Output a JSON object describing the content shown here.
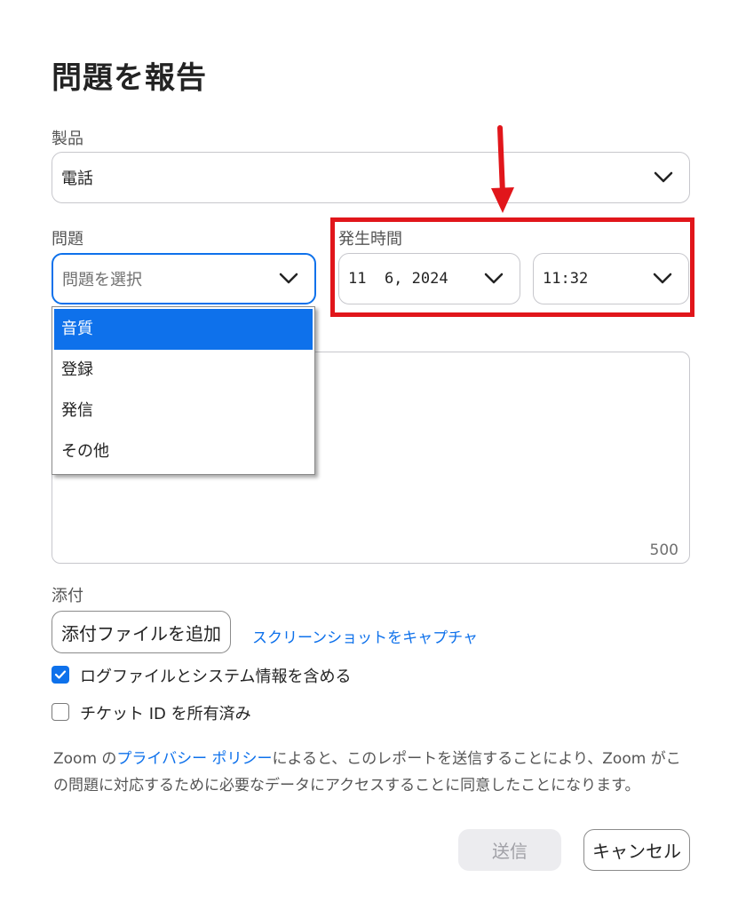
{
  "dialog": {
    "title": "問題を報告"
  },
  "product": {
    "label": "製品",
    "value": "電話"
  },
  "issue": {
    "label": "問題",
    "placeholder": "問題を選択",
    "options": [
      "音質",
      "登録",
      "発信",
      "その他"
    ],
    "highlighted_option": "音質"
  },
  "occurrence": {
    "label": "発生時間",
    "date_value": "11  6, 2024",
    "time_value": "11:32"
  },
  "description": {
    "char_counter": "500"
  },
  "attachments": {
    "label": "添付",
    "add_button": "添付ファイルを追加",
    "capture_link": "スクリーンショットをキャプチャ"
  },
  "checkboxes": [
    {
      "label": "ログファイルとシステム情報を含める",
      "checked": true
    },
    {
      "label": "チケット ID を所有済み",
      "checked": false
    }
  ],
  "privacy_note": {
    "before": "Zoom の",
    "link": "プライバシー ポリシー",
    "after": "によると、このレポートを送信することにより、Zoom がこの問題に対応するために必要なデータにアクセスすることに同意したことになります。"
  },
  "footer": {
    "submit_label": "送信",
    "cancel_label": "キャンセル"
  },
  "colors": {
    "accent": "#0e71eb",
    "annotation_red": "#e1161b",
    "border": "#c7c7cc"
  }
}
